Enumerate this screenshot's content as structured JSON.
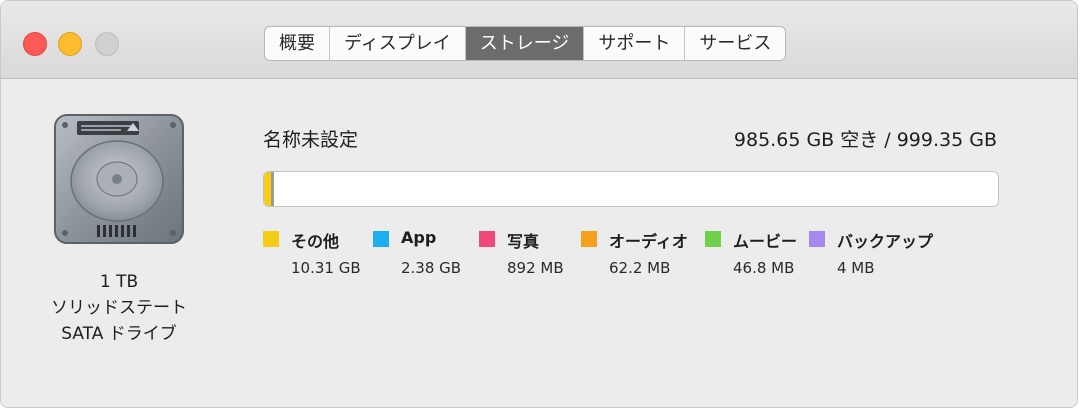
{
  "window": {
    "tabs": [
      {
        "label": "概要",
        "active": false
      },
      {
        "label": "ディスプレイ",
        "active": false
      },
      {
        "label": "ストレージ",
        "active": true
      },
      {
        "label": "サポート",
        "active": false
      },
      {
        "label": "サービス",
        "active": false
      }
    ]
  },
  "drive": {
    "capacity_label": "1 TB",
    "type_line1": "ソリッドステート",
    "type_line2": "SATA ドライブ",
    "icon": "hard-drive-icon"
  },
  "volume": {
    "name": "名称未設定",
    "capacity_text": "985.65 GB 空き / 999.35 GB",
    "used_fraction_of_total": 0.0137
  },
  "legend": [
    {
      "label": "その他",
      "size": "10.31 GB",
      "color": "#f5cc17"
    },
    {
      "label": "App",
      "size": "2.38 GB",
      "color": "#1daef0"
    },
    {
      "label": "写真",
      "size": "892 MB",
      "color": "#ef4a7a"
    },
    {
      "label": "オーディオ",
      "size": "62.2 MB",
      "color": "#f59f1b"
    },
    {
      "label": "ムービー",
      "size": "46.8 MB",
      "color": "#6ed14b"
    },
    {
      "label": "バックアップ",
      "size": "4 MB",
      "color": "#a689ee"
    }
  ],
  "colors": {
    "close": "#fc5a54",
    "minimize": "#fdbb2e",
    "zoom_inactive": "#d0d0d0",
    "active_tab": "#6c6c6c"
  }
}
